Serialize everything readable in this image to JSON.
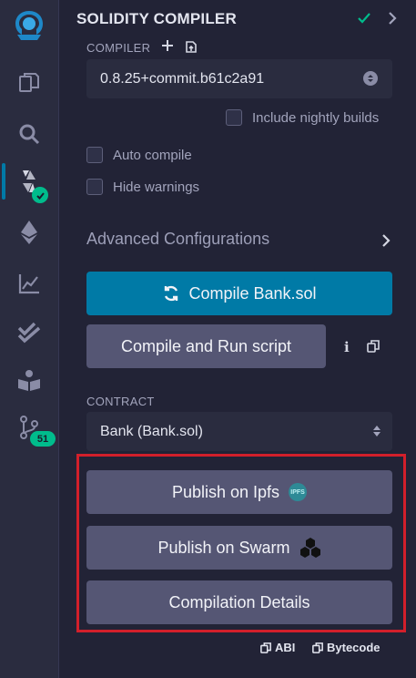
{
  "panel": {
    "title": "SOLIDITY COMPILER",
    "compiler_label": "COMPILER",
    "compiler_version": "0.8.25+commit.b61c2a91",
    "include_nightly_label": "Include nightly builds",
    "auto_compile_label": "Auto compile",
    "hide_warnings_label": "Hide warnings",
    "advanced_label": "Advanced Configurations",
    "compile_button": "Compile Bank.sol",
    "compile_run_button": "Compile and Run script",
    "contract_label": "CONTRACT",
    "contract_value": "Bank (Bank.sol)",
    "publish_ipfs": "Publish on Ipfs",
    "ipfs_badge": "IPFS",
    "publish_swarm": "Publish on Swarm",
    "compilation_details": "Compilation Details",
    "abi_label": "ABI",
    "bytecode_label": "Bytecode"
  },
  "iconbar": {
    "git_badge_count": "51",
    "icons": [
      "remix-logo-icon",
      "file-explorer-icon",
      "search-icon",
      "solidity-compiler-icon",
      "deploy-run-icon",
      "analysis-icon",
      "test-icon",
      "learneth-icon",
      "git-icon"
    ]
  },
  "colors": {
    "background": "#222336",
    "iconbar": "#2a2c3f",
    "primary": "#007aa6",
    "secondary": "#555674",
    "success": "#00bc8c",
    "highlight": "#d21f2b"
  }
}
